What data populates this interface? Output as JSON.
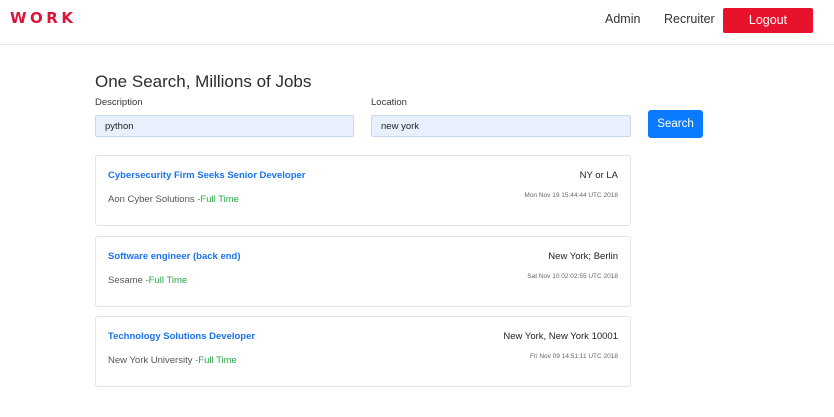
{
  "brand": "WORK",
  "nav": {
    "admin_label": "Admin",
    "recruiter_label": "Recruiter",
    "logout_label": "Logout"
  },
  "search": {
    "heading": "One Search, Millions of Jobs",
    "description_label": "Description",
    "description_value": "python",
    "location_label": "Location",
    "location_value": "new york",
    "button_label": "Search"
  },
  "jobs": [
    {
      "title": "Cybersecurity Firm Seeks Senior Developer",
      "company": "Aon Cyber Solutions",
      "type": "-Full Time",
      "location": "NY or LA",
      "date": "Mon Nov 19 15:44:44 UTC 2018"
    },
    {
      "title": "Software engineer (back end)",
      "company": "Sesame",
      "type": "-Full Time",
      "location": "New York; Berlin",
      "date": "Sat Nov 10 02:02:55 UTC 2018"
    },
    {
      "title": "Technology Solutions Developer",
      "company": "New York University",
      "type": "-Full Time",
      "location": "New York, New York 10001",
      "date": "Fri Nov 09 14:51:11 UTC 2018"
    }
  ],
  "colors": {
    "brand": "#dc143c",
    "logout": "#e8122d",
    "search_button": "#0a7bff",
    "job_title": "#1a73e8",
    "job_type": "#28a745",
    "input_bg": "#e8f0fe"
  }
}
